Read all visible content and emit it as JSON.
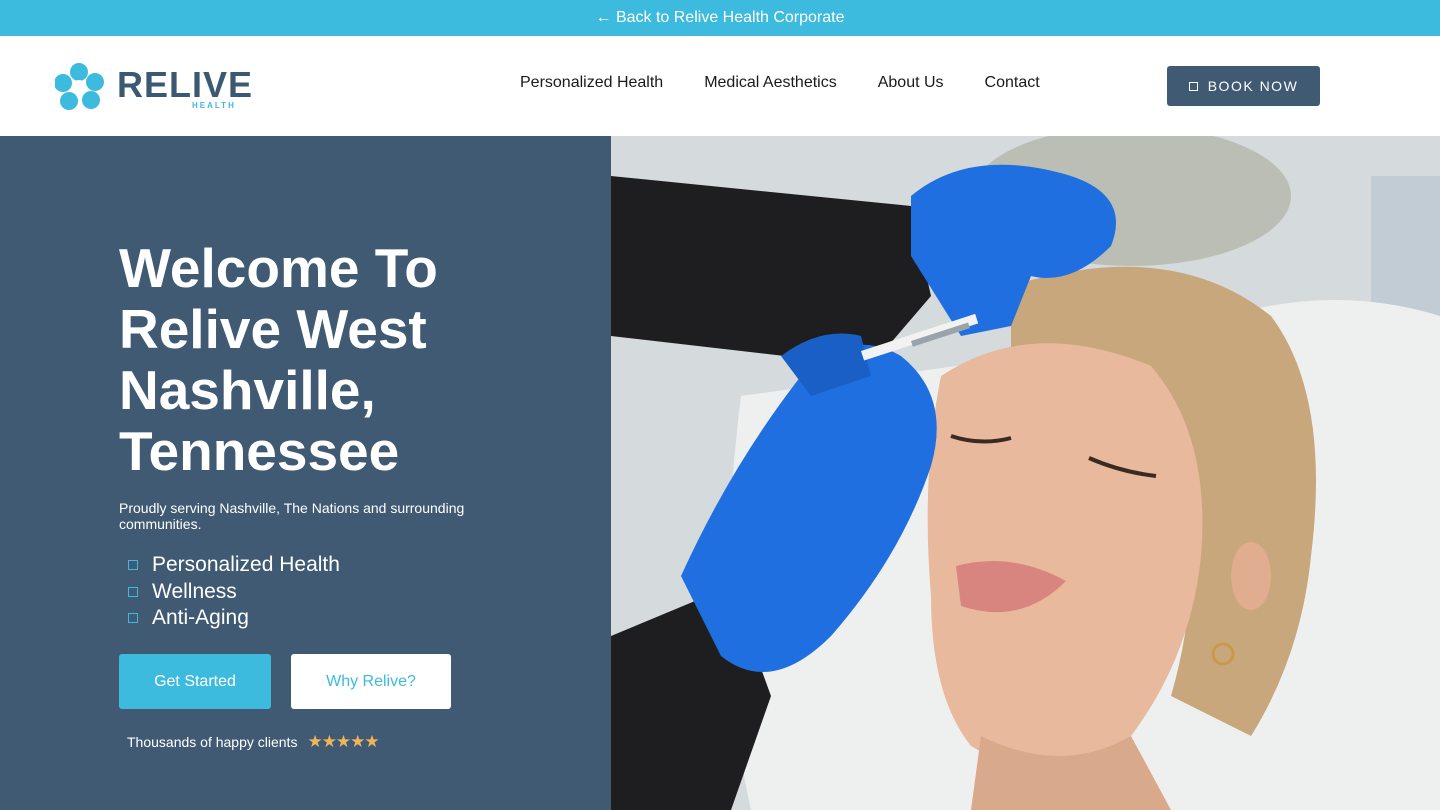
{
  "topbar": {
    "link_label": "← Back to Relive Health Corporate"
  },
  "brand": {
    "name": "RELIVE",
    "sub": "HEALTH"
  },
  "nav": {
    "items": [
      {
        "label": "Personalized Health"
      },
      {
        "label": "Medical Aesthetics"
      },
      {
        "label": "About Us"
      },
      {
        "label": "Contact"
      }
    ]
  },
  "header": {
    "book_label": "BOOK NOW"
  },
  "hero": {
    "title": "Welcome To Relive West Nashville, Tennessee",
    "subtitle": "Proudly serving Nashville, The Nations and surrounding communities.",
    "features": [
      "Personalized Health",
      "Wellness",
      "Anti-Aging"
    ],
    "primary_button": "Get Started",
    "secondary_button": "Why Relive?",
    "reviews_text": "Thousands of happy clients",
    "stars": "★★★★★",
    "rating_stars": 5
  },
  "colors": {
    "accent": "#3cbbdf",
    "navy": "#3f5a72",
    "star": "#f0b45a"
  },
  "icons": {
    "logo": "relive-flower-logo",
    "book": "square-icon",
    "bullet": "square-bullet-icon",
    "star": "star-icon"
  }
}
